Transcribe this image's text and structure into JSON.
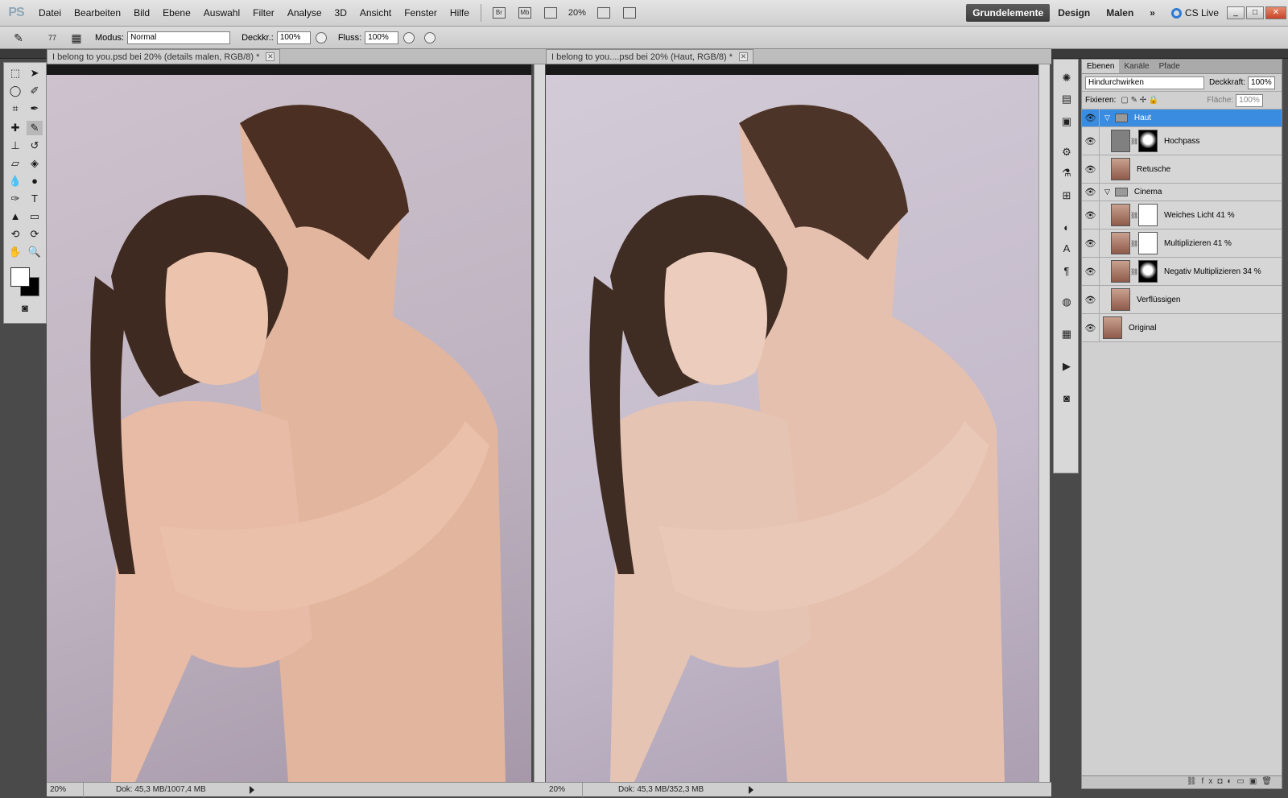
{
  "app": {
    "logo": "PS"
  },
  "menu": [
    "Datei",
    "Bearbeiten",
    "Bild",
    "Ebene",
    "Auswahl",
    "Filter",
    "Analyse",
    "3D",
    "Ansicht",
    "Fenster",
    "Hilfe"
  ],
  "menubar": {
    "bridge_label": "Br",
    "minibridge_label": "Mb",
    "zoom": "20%"
  },
  "workspaces": {
    "active": "Grundelemente",
    "design": "Design",
    "malen": "Malen",
    "more": "»",
    "cslive": "CS Live"
  },
  "options": {
    "brush_size": "77",
    "modus_label": "Modus:",
    "modus_value": "Normal",
    "deckkr_label": "Deckkr.:",
    "deckkr_value": "100%",
    "fluss_label": "Fluss:",
    "fluss_value": "100%"
  },
  "documents": [
    {
      "tab": "I belong to you.psd bei 20% (details malen, RGB/8) *",
      "zoom": "20%",
      "dok": "Dok: 45,3 MB/1007,4 MB"
    },
    {
      "tab": "I belong to you....psd bei 20% (Haut, RGB/8) *",
      "zoom": "20%",
      "dok": "Dok: 45,3 MB/352,3 MB"
    }
  ],
  "layers_panel": {
    "tabs": [
      "Ebenen",
      "Kanäle",
      "Pfade"
    ],
    "blend_mode": "Hindurchwirken",
    "deckkraft_label": "Deckkraft:",
    "deckkraft_value": "100%",
    "fixieren_label": "Fixieren:",
    "flaeche_label": "Fläche:",
    "flaeche_value": "100%",
    "layers": [
      {
        "name": "Haut"
      },
      {
        "name": "Hochpass"
      },
      {
        "name": "Retusche"
      },
      {
        "name": "Cinema"
      },
      {
        "name": "Weiches Licht 41 %"
      },
      {
        "name": "Multiplizieren 41 %"
      },
      {
        "name": "Negativ Multiplizieren 34 %"
      },
      {
        "name": "Verflüssigen"
      },
      {
        "name": "Original"
      }
    ]
  },
  "colors": {
    "selection": "#3a8ce0",
    "backdrop": "#c6bac8"
  }
}
